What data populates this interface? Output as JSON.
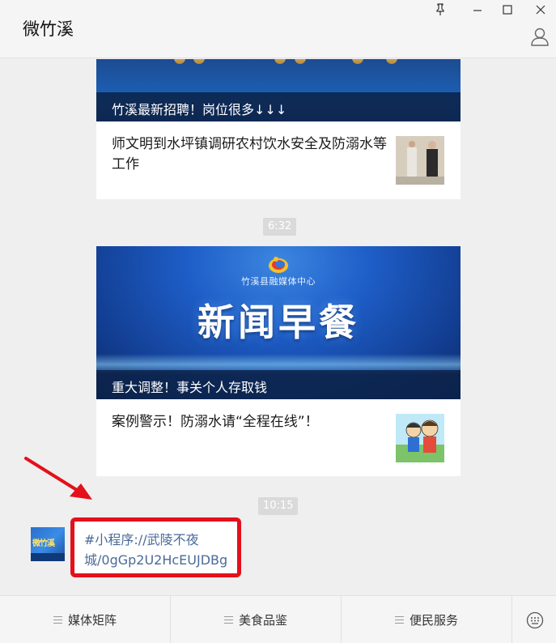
{
  "window": {
    "title": "微竹溪"
  },
  "messages": {
    "card1": {
      "caption": "竹溪最新招聘！岗位很多↓↓↓",
      "article": "师文明到水坪镇调研农村饮水安全及防溺水等工作"
    },
    "time1": "6:32",
    "card2": {
      "org": "竹溪县融媒体中心",
      "banner": "新闻早餐",
      "caption": "重大调整！事关个人存取钱",
      "article": "案例警示！防溺水请“全程在线”！"
    },
    "time2": "10:15",
    "avatar_text": "微竹溪",
    "bubble_text": "#小程序://武陵不夜城/0gGp2U2HcEUJDBg"
  },
  "menu": {
    "items": [
      {
        "label": "媒体矩阵"
      },
      {
        "label": "美食品鉴"
      },
      {
        "label": "便民服务"
      }
    ]
  },
  "colors": {
    "highlight_border": "#e4101a",
    "arrow": "#e4101a",
    "link_text": "#4a6a98"
  },
  "icons": [
    "pin-icon",
    "minimize-icon",
    "maximize-icon",
    "close-icon",
    "profile-icon",
    "menu-icon",
    "keyboard-icon",
    "arrow-annotation"
  ]
}
